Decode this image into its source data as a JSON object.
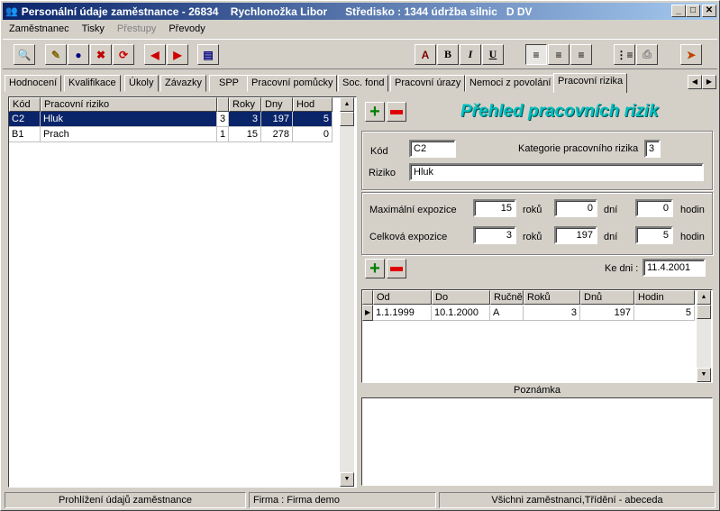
{
  "window": {
    "title": "Personální údaje zaměstnance - 26834    Rychlonožka Libor      Středisko : 1344 údržba silnic   D DV"
  },
  "menu": {
    "items": [
      "Zaměstnanec",
      "Tisky",
      "Přestupy",
      "Převody"
    ],
    "disabled_index": 2
  },
  "toolbar": {
    "bold_label": "B",
    "italic_label": "I",
    "underline_label": "U"
  },
  "tabs": [
    "Hodnocení",
    "Kvalifikace",
    "Úkoly",
    "Závazky",
    "SPP",
    "Pracovní pomůcky",
    "Soc. fond",
    "Pracovní úrazy",
    "Nemoci z povolání",
    "Pracovní rizika"
  ],
  "active_tab": "Pracovní rizika",
  "risk_table": {
    "columns": [
      "Kód",
      "Pracovní riziko",
      "",
      "Roky",
      "Dny",
      "Hod"
    ],
    "rows": [
      [
        "C2",
        "Hluk",
        "3",
        "3",
        "197",
        "5"
      ],
      [
        "B1",
        "Prach",
        "1",
        "15",
        "278",
        "0"
      ]
    ]
  },
  "detail": {
    "heading": "Přehled pracovních rizik",
    "kod_label": "Kód",
    "kod_value": "C2",
    "kategorie_label": "Kategorie pracovního rizika",
    "kategorie_value": "3",
    "riziko_label": "Riziko",
    "riziko_value": "Hluk",
    "max_label": "Maximální expozice",
    "max_roky": "15",
    "max_dni": "0",
    "max_hodin": "0",
    "celk_label": "Celková expozice",
    "celk_roky": "3",
    "celk_dni": "197",
    "celk_hodin": "5",
    "unit_roku": "roků",
    "unit_dni": "dní",
    "unit_hodin": "hodin",
    "ke_dni_label": "Ke dni :",
    "ke_dni_value": "11.4.2001"
  },
  "exposure_table": {
    "columns": [
      "Od",
      "Do",
      "Ručně",
      "Roků",
      "Dnů",
      "Hodin"
    ],
    "rows": [
      [
        "1.1.1999",
        "10.1.2000",
        "A",
        "3",
        "197",
        "5"
      ]
    ]
  },
  "note_label": "Poznámka",
  "status": {
    "left": "Prohlížení údajů zaměstnance",
    "middle": "Firma :   Firma demo",
    "right": "Všichni zaměstnanci,Třídění - abeceda"
  }
}
